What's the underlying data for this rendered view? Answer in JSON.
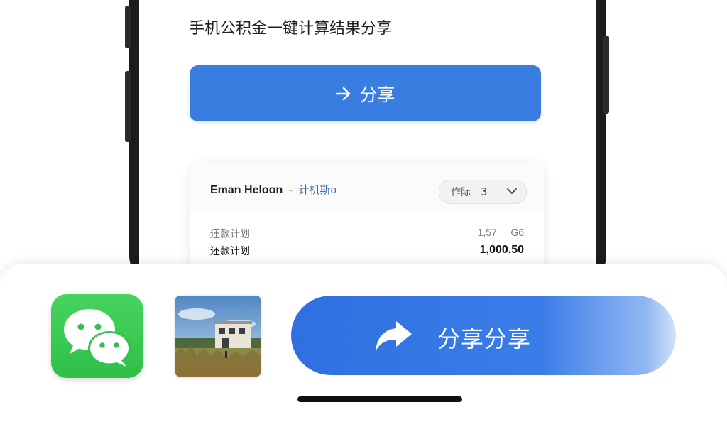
{
  "page": {
    "title": "手机公积金一键计算结果分享",
    "share_button_label": "分享"
  },
  "card": {
    "name": "Eman Helоon",
    "separator": "-",
    "subtitle": "计机斯o",
    "pill_label": "作际",
    "pill_value": "3",
    "rows": [
      {
        "label": "还款计划",
        "value": "1,57     G6"
      },
      {
        "label": "还款计划",
        "value": "1,000.50"
      }
    ]
  },
  "share_sheet": {
    "wechat_icon": "wechat-icon",
    "thumbnail_icon": "house-photo",
    "share_label": "分享分享",
    "accent": "#3a7de0"
  }
}
